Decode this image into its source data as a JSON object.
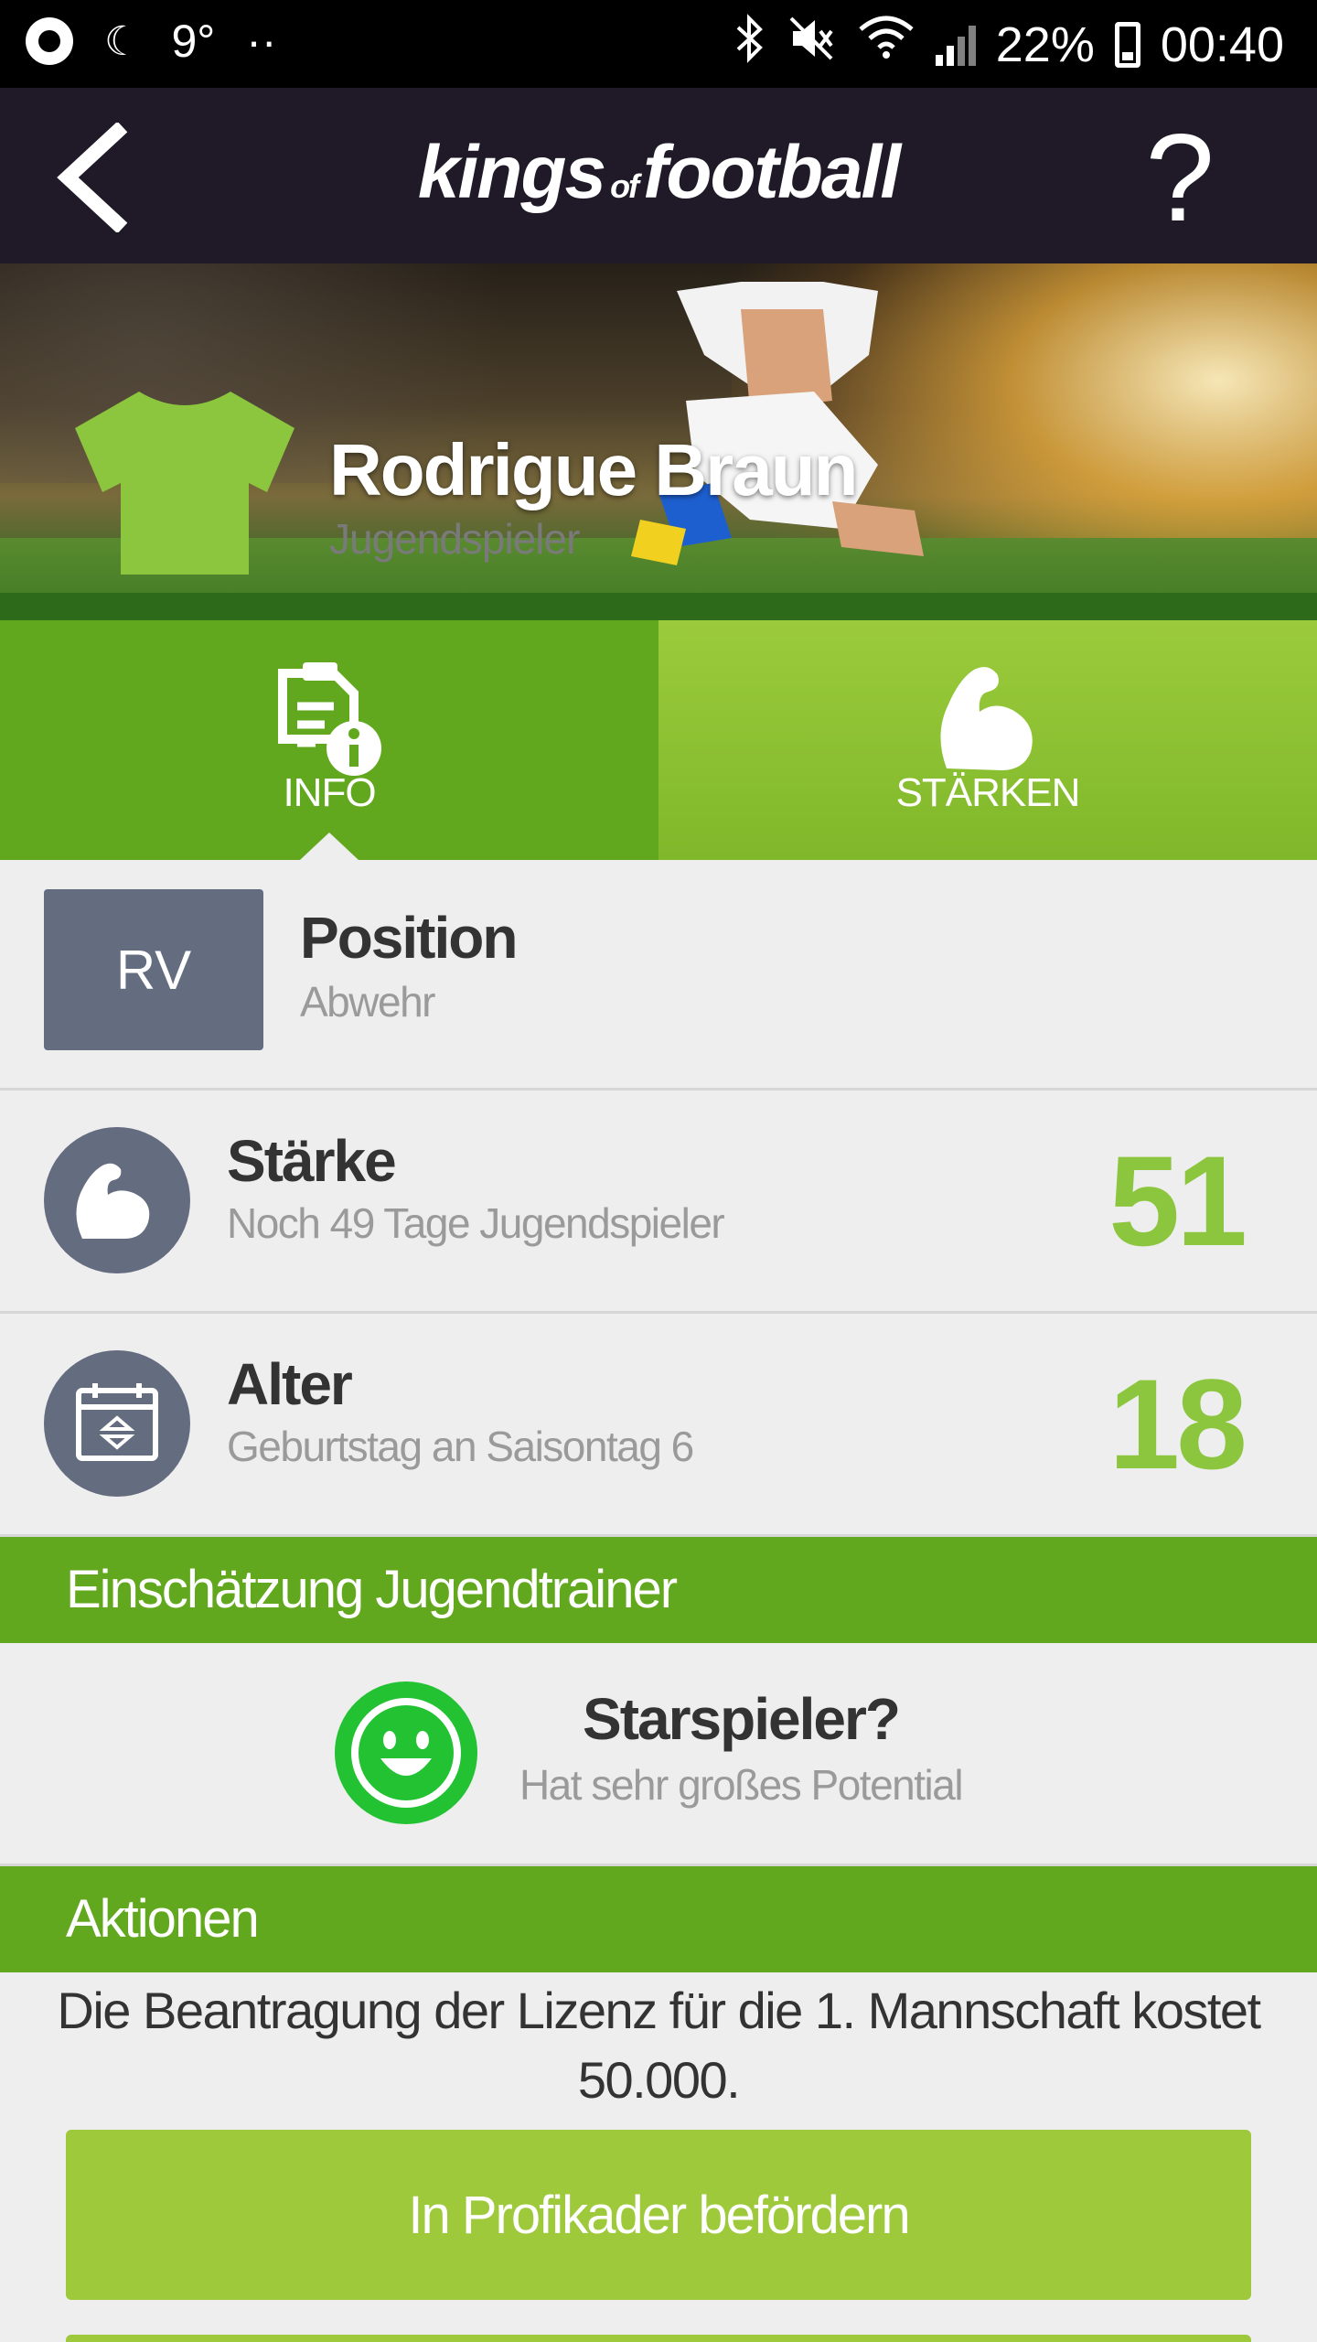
{
  "status_bar": {
    "temperature": "9°",
    "dots": "··",
    "battery_percent": "22%",
    "time": "00:40"
  },
  "header": {
    "logo_kings": "kings",
    "logo_of": "of",
    "logo_football": "football",
    "help": "?"
  },
  "player": {
    "name": "Rodrigue Braun",
    "role": "Jugendspieler",
    "shirt_color": "#8cc63f"
  },
  "tabs": [
    {
      "label": "INFO",
      "icon": "document-info-icon",
      "active": true
    },
    {
      "label": "STÄRKEN",
      "icon": "flexed-arm-icon",
      "active": false
    }
  ],
  "position": {
    "badge": "RV",
    "title": "Position",
    "subtitle": "Abwehr"
  },
  "strength": {
    "title": "Stärke",
    "subtitle": "Noch 49 Tage Jugendspieler",
    "value": "51"
  },
  "age": {
    "title": "Alter",
    "subtitle": "Geburtstag an Saisontag 6",
    "value": "18"
  },
  "coach_section": {
    "header": "Einschätzung Jugendtrainer",
    "title": "Starspieler?",
    "subtitle": "Hat sehr großes Potential",
    "icon": "smiley-icon"
  },
  "actions_section": {
    "header": "Aktionen",
    "text": "Die Beantragung der Lizenz für die 1. Mannschaft kostet 50.000.",
    "promote_button": "In Profikader befördern"
  },
  "colors": {
    "accent_green": "#62a81e",
    "light_green": "#9dc93a",
    "value_green": "#8cc63f",
    "header_dark": "#201a28",
    "badge_gray": "#646c80"
  }
}
